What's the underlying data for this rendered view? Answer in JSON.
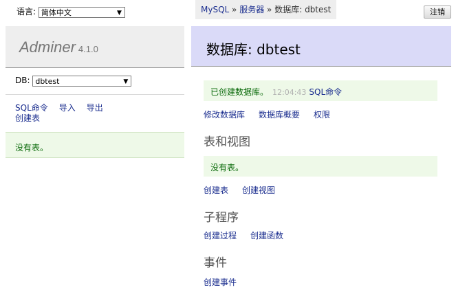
{
  "language": {
    "label": "语言:",
    "selected": "简体中文"
  },
  "logo": {
    "name": "Adminer",
    "version": "4.1.0"
  },
  "db_select": {
    "label": "DB:",
    "selected": "dbtest"
  },
  "left_links": {
    "sql": "SQL命令",
    "import": "导入",
    "export": "导出",
    "create_table": "创建表"
  },
  "left_message": "没有表。",
  "breadcrumb": {
    "mysql": "MySQL",
    "sep1": "»",
    "server": "服务器",
    "sep2": "»",
    "current": "数据库: dbtest"
  },
  "logout": "注销",
  "page_title": "数据库: dbtest",
  "created_message": {
    "text": "已创建数据库。",
    "time": "12:04:43",
    "sql_link": "SQL命令"
  },
  "db_actions": {
    "alter": "修改数据库",
    "schema": "数据库概要",
    "privileges": "权限"
  },
  "sections": {
    "tables": {
      "heading": "表和视图",
      "message": "没有表。",
      "create_table": "创建表",
      "create_view": "创建视图"
    },
    "routines": {
      "heading": "子程序",
      "create_procedure": "创建过程",
      "create_function": "创建函数"
    },
    "events": {
      "heading": "事件",
      "create_event": "创建事件"
    }
  }
}
